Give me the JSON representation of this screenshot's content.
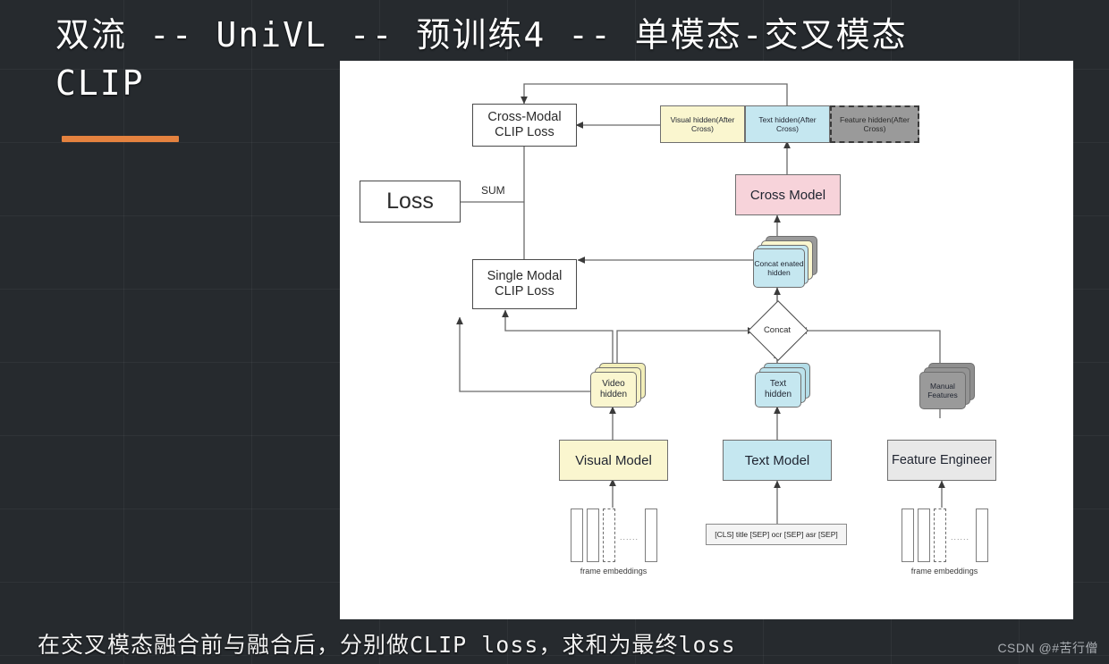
{
  "slide": {
    "title": "双流 -- UniVL -- 预训练4 -- 单模态-交叉模态 CLIP",
    "caption": "在交叉模态融合前与融合后，分别做CLIP loss，求和为最终loss",
    "watermark": "CSDN @#苦行僧",
    "accent_color": "#e4823f",
    "background_color": "#262a2e"
  },
  "diagram": {
    "nodes": {
      "cross_modal_clip_loss": "Cross-Modal\nCLIP Loss",
      "loss": "Loss",
      "single_modal_clip_loss": "Single Modal\nCLIP Loss",
      "visual_hidden_after_cross": "Visual hidden(After Cross)",
      "text_hidden_after_cross": "Text hidden(After Cross)",
      "feature_hidden_after_cross": "Feature hidden(After Cross)",
      "cross_model": "Cross Model",
      "concatenated_hidden": "Concat enated hidden",
      "concat": "Concat",
      "video_hidden": "Video hidden",
      "text_hidden": "Text hidden",
      "manual_features": "Manual Features",
      "visual_model": "Visual Model",
      "text_model": "Text Model",
      "feature_engineer": "Feature Engineer",
      "text_input": "[CLS] title [SEP] ocr [SEP] asr [SEP]",
      "frame_embeddings_left": "frame embeddings",
      "frame_embeddings_right": "frame embeddings",
      "dots_left": "......",
      "dots_right": "......"
    },
    "edge_labels": {
      "sum": "SUM"
    },
    "colors": {
      "yellow": "#faf6cf",
      "blue": "#c5e7f0",
      "pink": "#f7d3da",
      "gray_light": "#e8e8e8",
      "gray_dark": "#9a9a9a",
      "stroke": "#4a4a4a",
      "panel": "#ffffff"
    }
  }
}
